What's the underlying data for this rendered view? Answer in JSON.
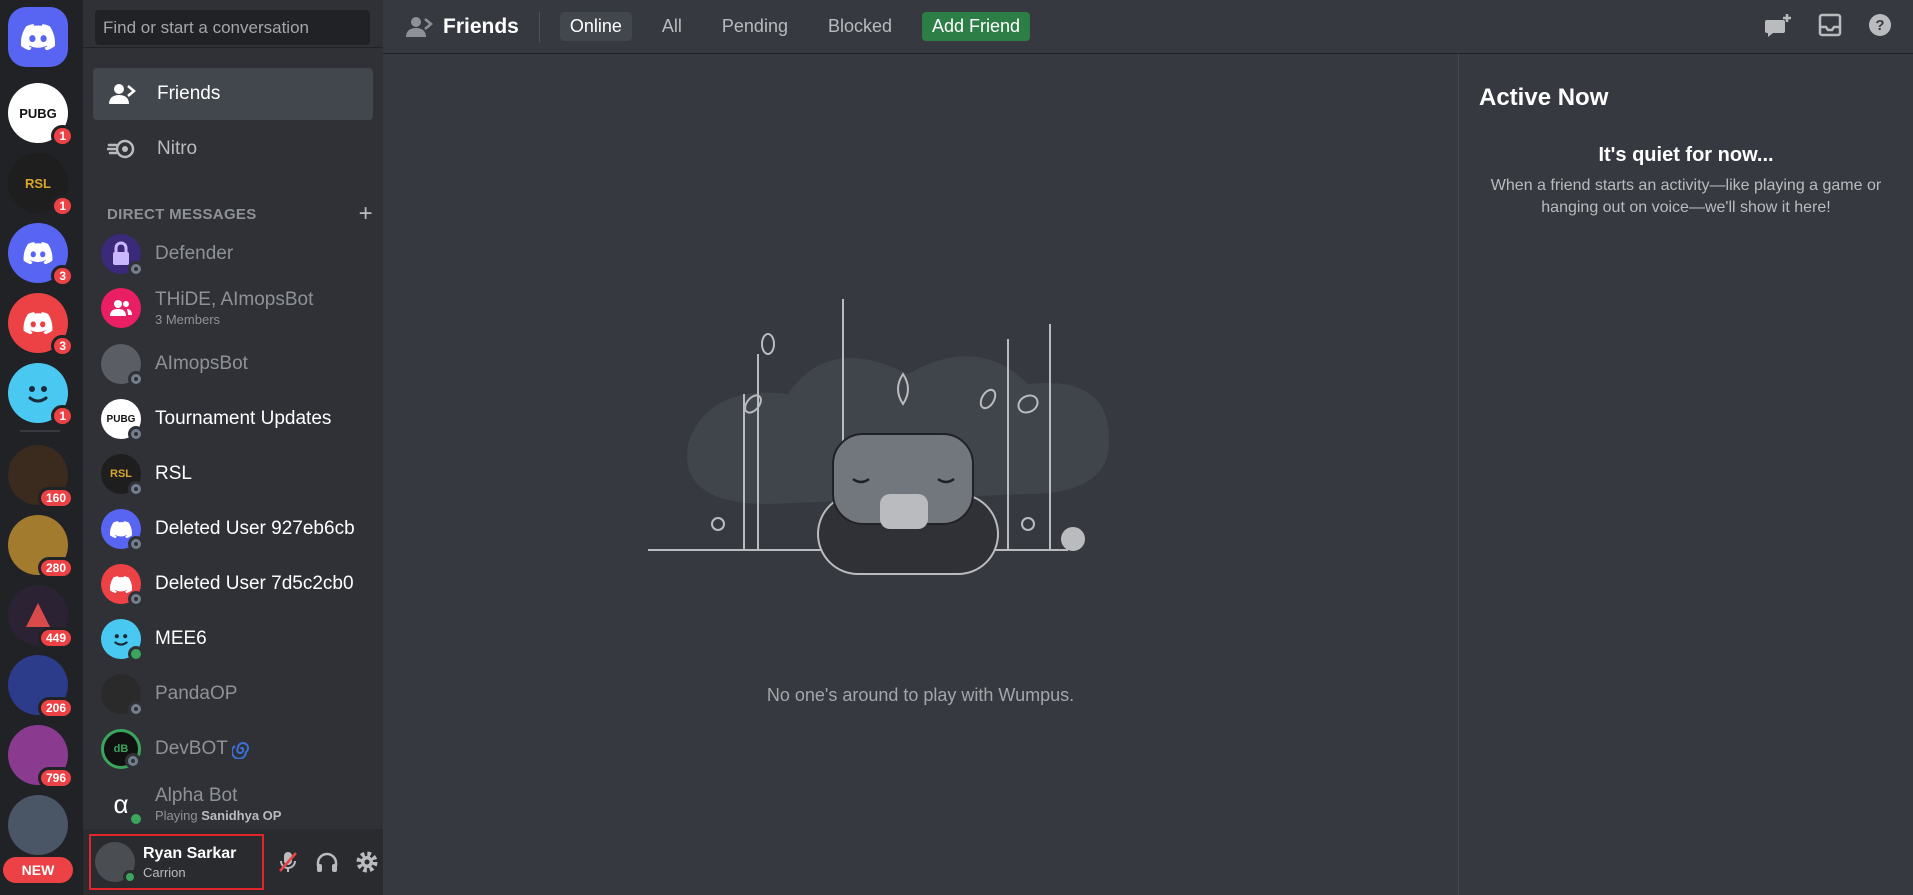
{
  "guilds": [
    {
      "id": "home",
      "label": "Home"
    },
    {
      "label": "PUBG",
      "badge": "1"
    },
    {
      "label": "RSL",
      "badge": "1"
    },
    {
      "label": "",
      "badge": "3"
    },
    {
      "label": "",
      "badge": "3"
    },
    {
      "label": "",
      "badge": "1"
    },
    {
      "label": "",
      "badge": "160"
    },
    {
      "label": "",
      "badge": "280"
    },
    {
      "label": "",
      "badge": "449"
    },
    {
      "label": "",
      "badge": "206"
    },
    {
      "label": "",
      "badge": "796"
    },
    {
      "label": "",
      "badge": ""
    }
  ],
  "rail": {
    "new_label": "NEW"
  },
  "sidebar": {
    "search_placeholder": "Find or start a conversation",
    "nav": [
      {
        "label": "Friends"
      },
      {
        "label": "Nitro"
      }
    ],
    "dm_header": "DIRECT MESSAGES",
    "dms": [
      {
        "name": "Defender",
        "sub": "",
        "status": "offline"
      },
      {
        "name": "THiDE, AImopsBot",
        "sub": "3 Members",
        "status": ""
      },
      {
        "name": "AImopsBot",
        "sub": "",
        "status": "offline"
      },
      {
        "name": "Tournament Updates",
        "sub": "",
        "status": "offline"
      },
      {
        "name": "RSL",
        "sub": "",
        "status": "offline"
      },
      {
        "name": "Deleted User 927eb6cb",
        "sub": "",
        "status": "offline"
      },
      {
        "name": "Deleted User 7d5c2cb0",
        "sub": "",
        "status": "offline"
      },
      {
        "name": "MEE6",
        "sub": "",
        "status": "online"
      },
      {
        "name": "PandaOP",
        "sub": "",
        "status": "offline"
      },
      {
        "name": "DevBOT",
        "sub": "",
        "status": "offline"
      },
      {
        "name": "Alpha Bot",
        "sub_prefix": "Playing ",
        "sub_bold": "Sanidhya OP",
        "status": "online"
      }
    ]
  },
  "user": {
    "name": "Ryan Sarkar",
    "status": "Carrion"
  },
  "topbar": {
    "title": "Friends",
    "tabs": [
      "Online",
      "All",
      "Pending",
      "Blocked"
    ],
    "add_friend": "Add Friend"
  },
  "center": {
    "empty_text": "No one's around to play with Wumpus."
  },
  "active_now": {
    "title": "Active Now",
    "quiet": "It's quiet for now...",
    "desc": "When a friend starts an activity—like playing a game or hanging out on voice—we'll show it here!"
  },
  "colors": {
    "blurple": "#5865f2",
    "red": "#ed4245",
    "green": "#3ba55d",
    "add_friend_green": "#2d7d46"
  }
}
